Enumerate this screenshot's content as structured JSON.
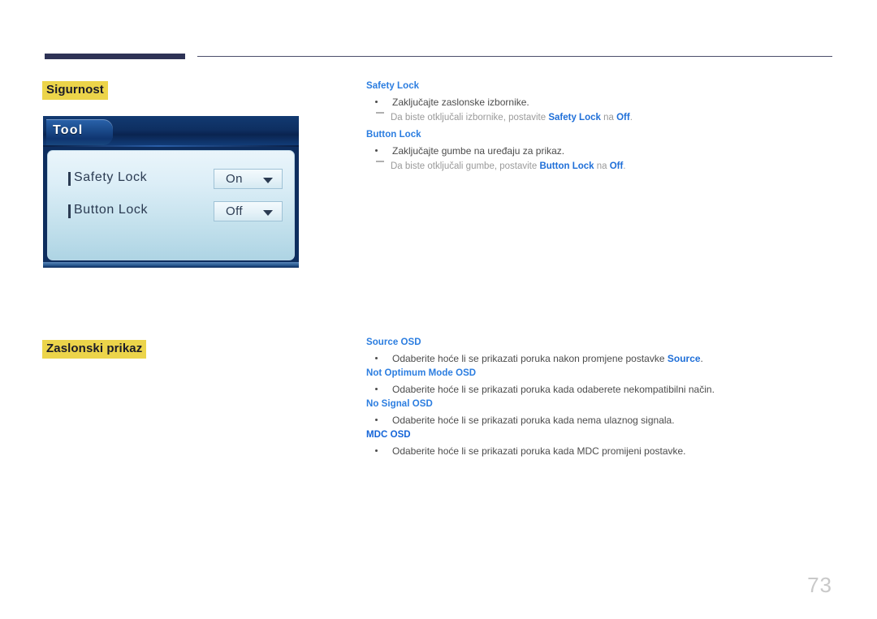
{
  "page": {
    "number": "73"
  },
  "sections": [
    {
      "heading": "Sigurnost",
      "terms": [
        {
          "name": "Safety Lock",
          "bullet": "Zaključajte zaslonske izbornike.",
          "note_pre": "Da biste otključali izbornike, postavite ",
          "note_b1": "Safety Lock",
          "note_mid": " na ",
          "note_b2": "Off",
          "note_post": "."
        },
        {
          "name": "Button Lock",
          "bullet": "Zaključajte gumbe na uređaju za prikaz.",
          "note_pre": "Da biste otključali gumbe, postavite ",
          "note_b1": "Button Lock",
          "note_mid": " na ",
          "note_b2": "Off",
          "note_post": "."
        }
      ]
    },
    {
      "heading": "Zaslonski prikaz",
      "terms": [
        {
          "name": "Source OSD",
          "bullet_pre": "Odaberite hoće li se prikazati poruka nakon promjene postavke ",
          "bullet_b": "Source",
          "bullet_post": "."
        },
        {
          "name": "Not Optimum Mode OSD",
          "bullet": "Odaberite hoće li se prikazati poruka kada odaberete nekompatibilni način."
        },
        {
          "name": "No Signal OSD",
          "bullet": "Odaberite hoće li se prikazati poruka kada nema ulaznog signala."
        },
        {
          "name": "MDC OSD",
          "bullet": "Odaberite hoće li se prikazati poruka kada MDC promijeni postavke."
        }
      ]
    }
  ],
  "osd": {
    "tab_label": "Tool",
    "rows": [
      {
        "label": "Safety Lock",
        "value": "On"
      },
      {
        "label": "Button Lock",
        "value": "Off"
      }
    ]
  },
  "colors": {
    "highlight": "#ecd44a",
    "rule": "#2e3356",
    "term_blue": "#2b7de0",
    "inline_blue": "#1f6fd8",
    "note_gray": "#9a9a9a"
  }
}
